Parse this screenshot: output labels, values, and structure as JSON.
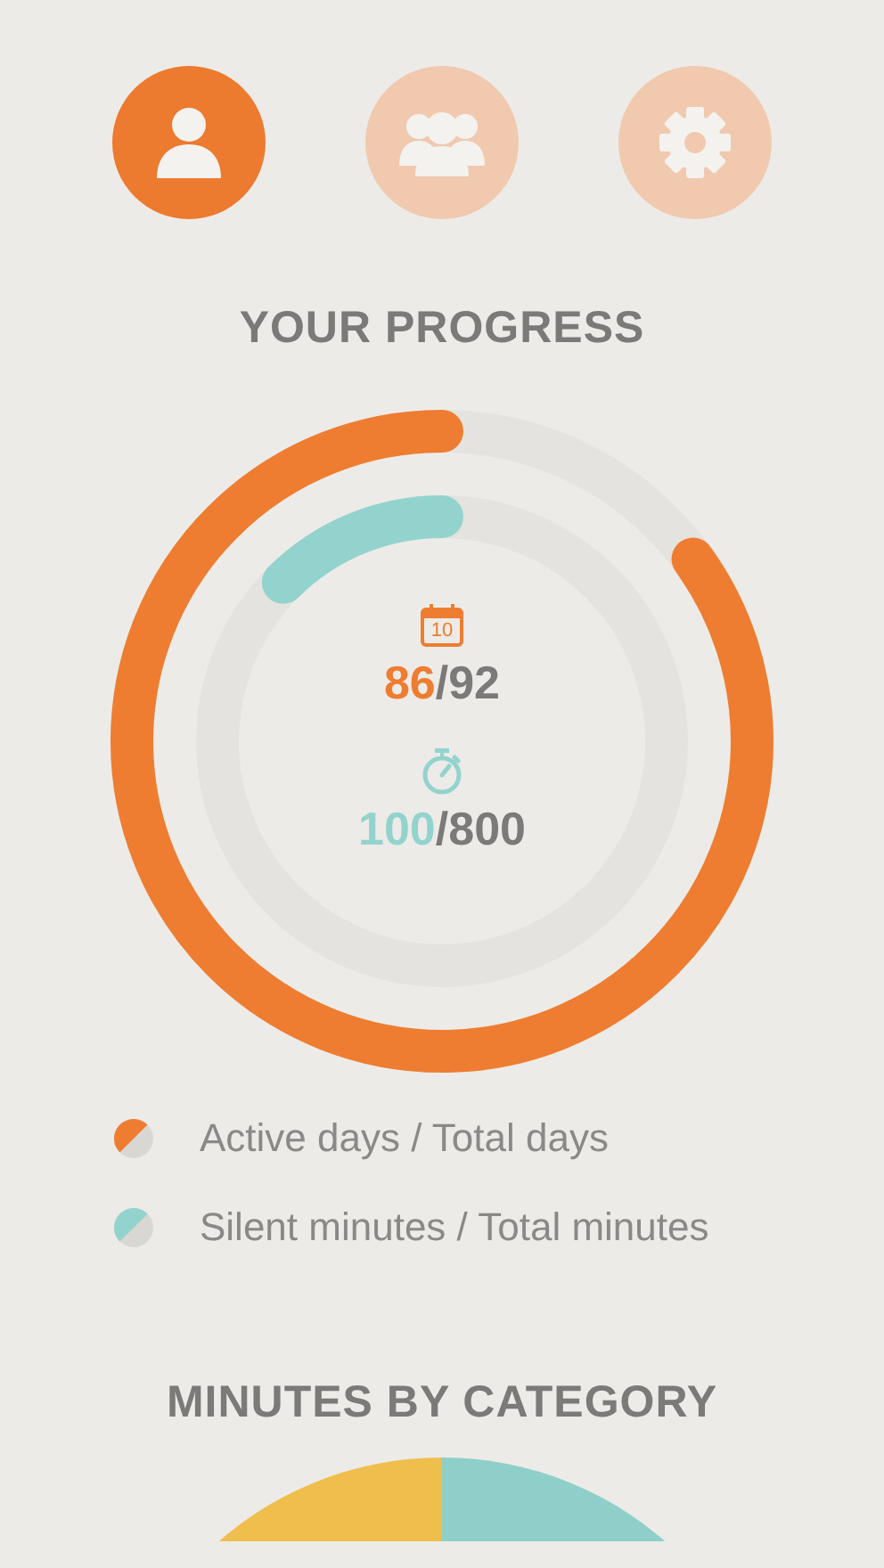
{
  "tabs": [
    {
      "kind": "user",
      "selected": true
    },
    {
      "kind": "group",
      "selected": false
    },
    {
      "kind": "settings",
      "selected": false
    }
  ],
  "progress": {
    "title": "YOUR PROGRESS",
    "rings": [
      {
        "kind": "calendar",
        "level": 0.85,
        "color": "#ee7d31",
        "value": "86",
        "total": "/92",
        "icon_text": "10"
      },
      {
        "kind": "stopwatch",
        "level": 0.125,
        "color": "#93d3ce",
        "value": "100",
        "total": "/800"
      }
    ]
  },
  "legend": [
    {
      "label": "Active days / Total days",
      "color": "#ee7d31"
    },
    {
      "label": "Silent minutes / Total minutes",
      "color": "#93d3ce"
    }
  ],
  "category": {
    "title": "MINUTES BY CATEGORY"
  }
}
